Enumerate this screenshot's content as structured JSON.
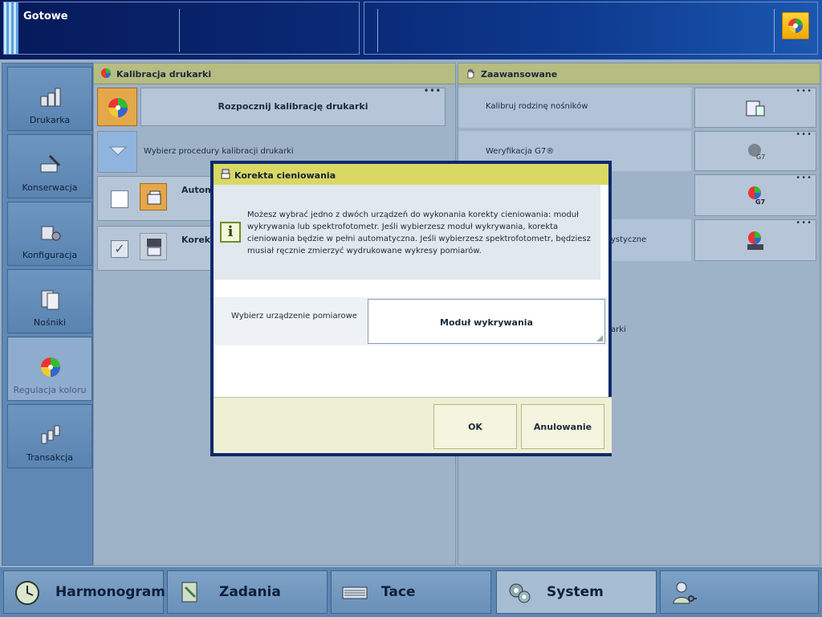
{
  "status": {
    "text": "Gotowe"
  },
  "colors": {
    "accent": "#0c2a6a",
    "panel_header": "#b6bd82",
    "modal_title": "#d9d865",
    "status_bar": "#0a2a78"
  },
  "left_nav": {
    "items": [
      {
        "label": "Drukarka",
        "icon": "printer-icon"
      },
      {
        "label": "Konserwacja",
        "icon": "maintenance-icon"
      },
      {
        "label": "Konfiguracja",
        "icon": "configuration-icon"
      },
      {
        "label": "Nośniki",
        "icon": "media-icon"
      },
      {
        "label": "Regulacja koloru",
        "icon": "color-wheel-icon",
        "active": true
      },
      {
        "label": "Transakcja",
        "icon": "transaction-icon"
      }
    ]
  },
  "calibration_panel": {
    "title": "Kalibracja drukarki",
    "start_button": "Rozpocznij kalibrację drukarki",
    "procedure_select": "Wybierz procedury kalibracji drukarki",
    "row1_label": "Autom",
    "row2_label": "Koreko"
  },
  "advanced_panel": {
    "title": "Zaawansowane",
    "items": [
      {
        "label": "Kalibruj rodzinę nośników"
      },
      {
        "label": "Weryfikacja G7®"
      },
      {
        "label": ""
      },
      {
        "label": "ystyczne"
      },
      {
        "label": "arki"
      }
    ]
  },
  "dialog": {
    "title": "Korekta cieniowania",
    "message": "Możesz wybrać jedno z dwóch urządzeń do wykonania korekty cieniowania: moduł wykrywania lub spektrofotometr. Jeśli wybierzesz moduł wykrywania, korekta cieniowania będzie w pełni automatyczna. Jeśli wybierzesz spektrofotometr, będziesz musiał ręcznie zmierzyć wydrukowane wykresy pomiarów.",
    "field_label": "Wybierz urządzenie pomiarowe",
    "field_value": "Moduł wykrywania",
    "ok_label": "OK",
    "cancel_label": "Anulowanie"
  },
  "bottom_nav": {
    "items": [
      {
        "label": "Harmonogram",
        "icon": "clock-icon"
      },
      {
        "label": "Zadania",
        "icon": "jobs-icon"
      },
      {
        "label": "Tace",
        "icon": "trays-icon"
      },
      {
        "label": "System",
        "icon": "system-gears-icon",
        "active": true
      },
      {
        "label": "",
        "icon": "user-key-icon"
      }
    ]
  }
}
